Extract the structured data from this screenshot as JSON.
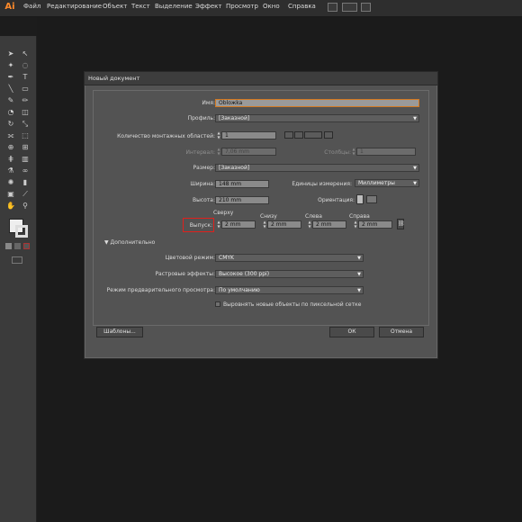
{
  "app": {
    "logo": "Ai"
  },
  "menubar": {
    "items": [
      "Файл",
      "Редактирование",
      "Объект",
      "Текст",
      "Выделение",
      "Эффект",
      "Просмотр",
      "Окно",
      "Справка"
    ]
  },
  "dialog": {
    "title": "Новый документ",
    "name": {
      "label": "Имя:",
      "value": "Obloжka"
    },
    "profile": {
      "label": "Профиль:",
      "value": "[Заказной]"
    },
    "artboards": {
      "label": "Количество монтажных областей:",
      "value": "1"
    },
    "interval": {
      "label": "Интервал:",
      "value": "7,06 mm"
    },
    "columns": {
      "label": "Столбцы:",
      "value": "1"
    },
    "size": {
      "label": "Размер:",
      "value": "[Заказной]"
    },
    "width": {
      "label": "Ширина:",
      "value": "148 mm"
    },
    "height": {
      "label": "Высота:",
      "value": "210 mm"
    },
    "units": {
      "label": "Единицы измерения:",
      "value": "Миллиметры"
    },
    "orientation": {
      "label": "Ориентация:"
    },
    "bleed": {
      "label": "Выпуск:",
      "top_label": "Сверху",
      "top": "2 mm",
      "bottom_label": "Снизу",
      "bottom": "2 mm",
      "left_label": "Слева",
      "left": "2 mm",
      "right_label": "Справа",
      "right": "2 mm"
    },
    "advanced": {
      "header": "Дополнительно",
      "color_mode": {
        "label": "Цветовой режим:",
        "value": "CMYK"
      },
      "raster": {
        "label": "Растровые эффекты:",
        "value": "Высокое (300 ppi)"
      },
      "preview": {
        "label": "Режим предварительного просмотра:",
        "value": "По умолчанию"
      },
      "align_pixel": {
        "label": "Выровнять новые объекты по пиксельной сетке"
      }
    },
    "buttons": {
      "templates": "Шаблоны...",
      "ok": "ОК",
      "cancel": "Отмена"
    }
  }
}
